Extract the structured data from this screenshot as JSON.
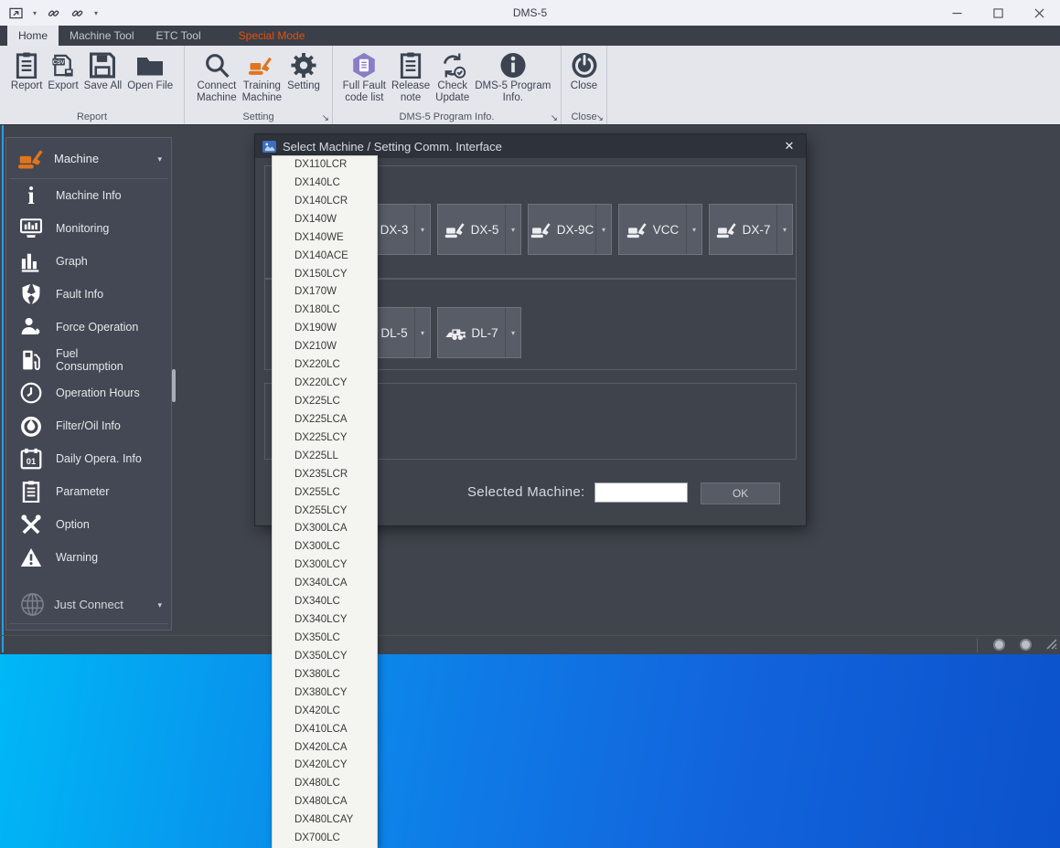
{
  "window": {
    "title": "DMS-5",
    "quick_access_icons": [
      "app-window-icon",
      "caret-down-icon",
      "link-icon",
      "link-icon",
      "caret-down-icon"
    ],
    "controls": [
      {
        "name": "minimize",
        "icon": "minimize-glyph"
      },
      {
        "name": "maximize",
        "icon": "maximize-glyph"
      },
      {
        "name": "close",
        "icon": "close-glyph"
      }
    ]
  },
  "tabs": [
    {
      "label": "Home",
      "state": "active"
    },
    {
      "label": "Machine Tool",
      "state": "normal"
    },
    {
      "label": "ETC Tool",
      "state": "normal"
    },
    {
      "label": "Special Mode",
      "state": "special"
    }
  ],
  "ribbon": {
    "groups": [
      {
        "label": "Report",
        "buttons": [
          {
            "label": "Report",
            "icon": "report-icon"
          },
          {
            "label": "Export",
            "icon": "export-csv-icon"
          },
          {
            "label": "Save All",
            "icon": "save-all-icon"
          },
          {
            "label": "Open File",
            "icon": "open-file-icon"
          }
        ]
      },
      {
        "label": "Setting",
        "launcher_icon": "launcher-icon",
        "buttons": [
          {
            "label": "Connect\nMachine",
            "icon": "connect-machine-icon"
          },
          {
            "label": "Training\nMachine",
            "icon": "training-machine-icon",
            "tone": "orange"
          },
          {
            "label": "Setting",
            "icon": "setting-icon"
          }
        ]
      },
      {
        "label": "DMS-5 Program Info.",
        "launcher_icon": "launcher-icon",
        "buttons": [
          {
            "label": "Full Fault\ncode list",
            "icon": "full-fault-icon"
          },
          {
            "label": "Release\nnote",
            "icon": "release-note-icon"
          },
          {
            "label": "Check\nUpdate",
            "icon": "check-update-icon"
          },
          {
            "label": "DMS-5 Program\nInfo.",
            "icon": "program-info-icon"
          }
        ]
      },
      {
        "label": "Close",
        "launcher_icon": "launcher-icon",
        "buttons": [
          {
            "label": "Close",
            "icon": "close-power-icon"
          }
        ]
      }
    ]
  },
  "sidebar": {
    "header": {
      "label": "Machine",
      "icon": "excavator-icon",
      "caret": "caret-down-icon"
    },
    "items": [
      {
        "label": "Machine Info",
        "icon": "machine-info-icon"
      },
      {
        "label": "Monitoring",
        "icon": "monitoring-icon"
      },
      {
        "label": "Graph",
        "icon": "graph-icon"
      },
      {
        "label": "Fault Info",
        "icon": "fault-info-icon"
      },
      {
        "label": "Force Operation",
        "icon": "force-operation-icon"
      },
      {
        "label": "Fuel\nConsumption",
        "icon": "fuel-icon"
      },
      {
        "label": "Operation Hours",
        "icon": "hours-icon"
      },
      {
        "label": "Filter/Oil Info",
        "icon": "filter-oil-icon"
      },
      {
        "label": "Daily Opera. Info",
        "icon": "daily-info-icon"
      },
      {
        "label": "Parameter",
        "icon": "parameter-icon"
      },
      {
        "label": "Option",
        "icon": "option-icon"
      },
      {
        "label": "Warning",
        "icon": "warning-icon"
      }
    ],
    "footer": {
      "label": "Just Connect",
      "icon": "globe-icon",
      "caret": "caret-down-icon"
    }
  },
  "dialog": {
    "title": "Select Machine / Setting Comm. Interface",
    "title_icon": "machine-thumb-icon",
    "close_icon": "dialog-close-icon",
    "split_caret": "split-caret-icon",
    "rows": [
      {
        "buttons": [
          {
            "label": "DX-3",
            "icon": "excavator-white-icon"
          },
          {
            "label": "DX-5",
            "icon": "excavator-white-icon"
          },
          {
            "label": "DX-9C",
            "icon": "excavator-white-icon"
          },
          {
            "label": "VCC",
            "icon": "excavator-white-icon"
          },
          {
            "label": "DX-7",
            "icon": "excavator-white-icon"
          }
        ]
      },
      {
        "buttons": [
          {
            "label": "DL-5",
            "icon": "wheel-loader-icon"
          },
          {
            "label": "DL-7",
            "icon": "wheel-loader-icon"
          }
        ]
      }
    ],
    "selected_machine_label": "Selected Machine:",
    "selected_machine_value": "",
    "ok_label": "OK"
  },
  "machine_list": [
    "DX110LCR",
    "DX140LC",
    "DX140LCR",
    "DX140W",
    "DX140WE",
    "DX140ACE",
    "DX150LCY",
    "DX170W",
    "DX180LC",
    "DX190W",
    "DX210W",
    "DX220LC",
    "DX220LCY",
    "DX225LC",
    "DX225LCA",
    "DX225LCY",
    "DX225LL",
    "DX235LCR",
    "DX255LC",
    "DX255LCY",
    "DX300LCA",
    "DX300LC",
    "DX300LCY",
    "DX340LCA",
    "DX340LC",
    "DX340LCY",
    "DX350LC",
    "DX350LCY",
    "DX380LC",
    "DX380LCY",
    "DX420LC",
    "DX410LCA",
    "DX420LCA",
    "DX420LCY",
    "DX480LC",
    "DX480LCA",
    "DX480LCAY",
    "DX700LC"
  ],
  "colors": {
    "special_mode_orange": "#e2520e",
    "training_orange": "#e0751d",
    "fault_hexagon_purple": "#8a7cc7",
    "accent_strip_blue": "#21a2ea",
    "desktop_blue": "#0f7ae6"
  }
}
